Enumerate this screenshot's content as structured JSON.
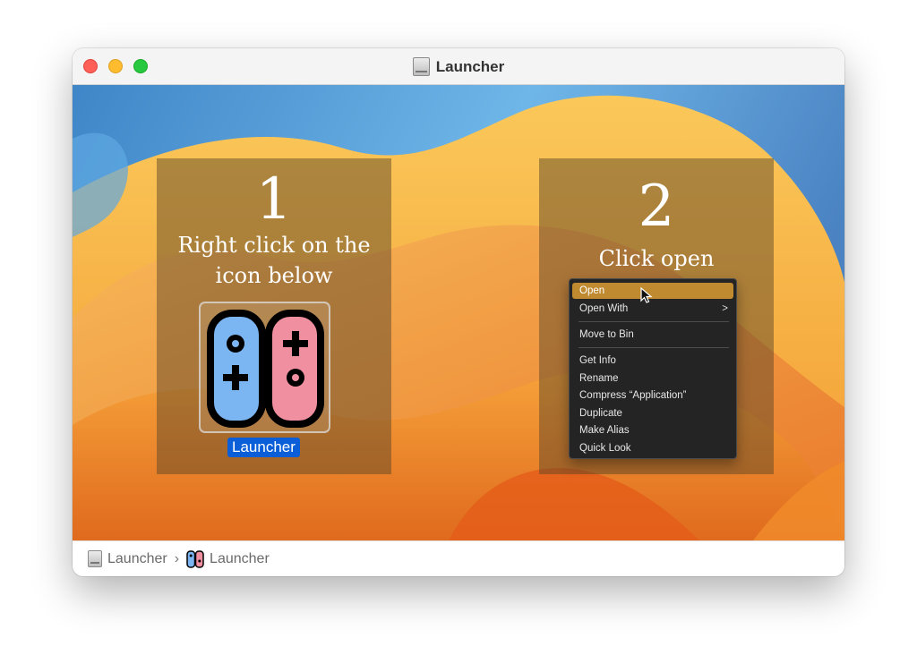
{
  "window": {
    "title": "Launcher",
    "title_icon": "disk-icon"
  },
  "steps": [
    {
      "number": "1",
      "text_line1": "Right click on the",
      "text_line2": "icon below"
    },
    {
      "number": "2",
      "text": "Click open"
    }
  ],
  "app_icon": {
    "label": "Launcher",
    "icon": "game-controller-icon",
    "colors": {
      "left": "#7cb6f2",
      "right": "#f08fa0"
    }
  },
  "context_menu": {
    "items": [
      {
        "label": "Open",
        "highlighted": true
      },
      {
        "label": "Open With",
        "submenu": true
      },
      {
        "label": "Move to Bin"
      },
      {
        "label": "Get Info"
      },
      {
        "label": "Rename"
      },
      {
        "label": "Compress “Application”"
      },
      {
        "label": "Duplicate"
      },
      {
        "label": "Make Alias"
      },
      {
        "label": "Quick Look"
      }
    ],
    "submenu_arrow": ">"
  },
  "path_bar": {
    "items": [
      {
        "label": "Launcher",
        "icon": "disk-icon"
      },
      {
        "label": "Launcher",
        "icon": "game-controller-icon"
      }
    ],
    "separator": "›"
  },
  "colors": {
    "highlight": "#c08a30",
    "selection": "#0a5fd8"
  }
}
